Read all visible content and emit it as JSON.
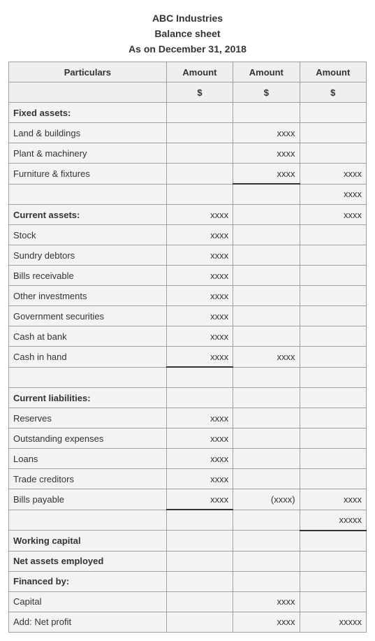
{
  "header": {
    "company": "ABC Industries",
    "doc_type": "Balance sheet",
    "date_line": "As on December 31, 2018"
  },
  "columns": {
    "c0": "Particulars",
    "c1": "Amount",
    "c2": "Amount",
    "c3": "Amount",
    "cur1": "$",
    "cur2": "$",
    "cur3": "$"
  },
  "x": "xxxx",
  "xp": "(xxxx)",
  "xx": "xxxxx",
  "sections": {
    "fixed_assets": {
      "title": "Fixed assets:",
      "items": [
        {
          "label": "Land & buildings"
        },
        {
          "label": "Plant & machinery"
        },
        {
          "label": "Furniture & fixtures"
        }
      ]
    },
    "current_assets": {
      "title": "Current assets:",
      "items": [
        {
          "label": "Stock"
        },
        {
          "label": "Sundry debtors"
        },
        {
          "label": "Bills receivable"
        },
        {
          "label": "Other investments"
        },
        {
          "label": "Government securities"
        },
        {
          "label": "Cash at bank"
        },
        {
          "label": "Cash in hand"
        }
      ]
    },
    "current_liabilities": {
      "title": "Current liabilities:",
      "items": [
        {
          "label": "Reserves"
        },
        {
          "label": "Outstanding expenses"
        },
        {
          "label": "Loans"
        },
        {
          "label": "Trade creditors"
        },
        {
          "label": "Bills payable"
        }
      ]
    },
    "working_capital": "Working capital",
    "net_assets": "Net assets employed",
    "financed_by": {
      "title": "Financed by:",
      "items": [
        {
          "label": "Capital"
        },
        {
          "label": "Add: Net profit"
        }
      ]
    }
  }
}
